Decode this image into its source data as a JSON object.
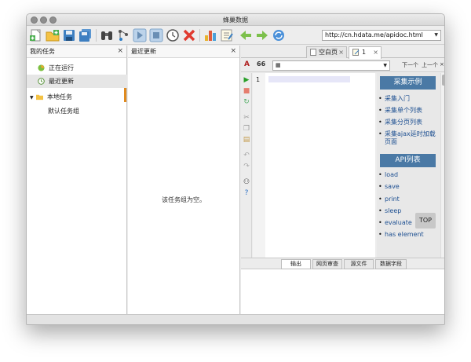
{
  "window": {
    "title": "蜂巢数据"
  },
  "toolbar": {
    "url": "http://cn.hdata.me/apidoc.html",
    "icons": [
      "new-file-icon",
      "new-folder-icon",
      "save-icon",
      "save-all-icon",
      "binoculars-icon",
      "debug-icon",
      "play-icon",
      "stop-icon",
      "clock-icon",
      "close-red-icon",
      "bar-chart-icon",
      "notepad-icon",
      "back-arrow-icon",
      "forward-arrow-icon",
      "refresh-icon"
    ]
  },
  "left_panel": {
    "title": "我的任务",
    "close": "×",
    "items": [
      {
        "label": "正在运行"
      },
      {
        "label": "最近更新"
      },
      {
        "label": "本地任务"
      },
      {
        "label": "默认任务组"
      }
    ]
  },
  "mid_panel": {
    "title": "最近更新",
    "close": "×",
    "empty": "该任务组为空。"
  },
  "editor": {
    "tabs": [
      {
        "label": "空白页",
        "close": "×"
      },
      {
        "label": "1",
        "close": "×"
      }
    ],
    "nav_next": "下一个",
    "nav_prev": "上一个",
    "nav_close": "×",
    "line_number": "1",
    "font_label": "A",
    "quote_label": "66"
  },
  "preview": {
    "section1_title": "采集示例",
    "section1_items": [
      "采集入门",
      "采集单个列表",
      "采集分页列表",
      "采集ajax延时加载页面"
    ],
    "section2_title": "API列表",
    "section2_items": [
      "load",
      "save",
      "print",
      "sleep",
      "evaluate",
      "has element"
    ],
    "top_button": "TOP"
  },
  "output_tabs": [
    "输出",
    "网页审查",
    "源文件",
    "数据字段"
  ]
}
